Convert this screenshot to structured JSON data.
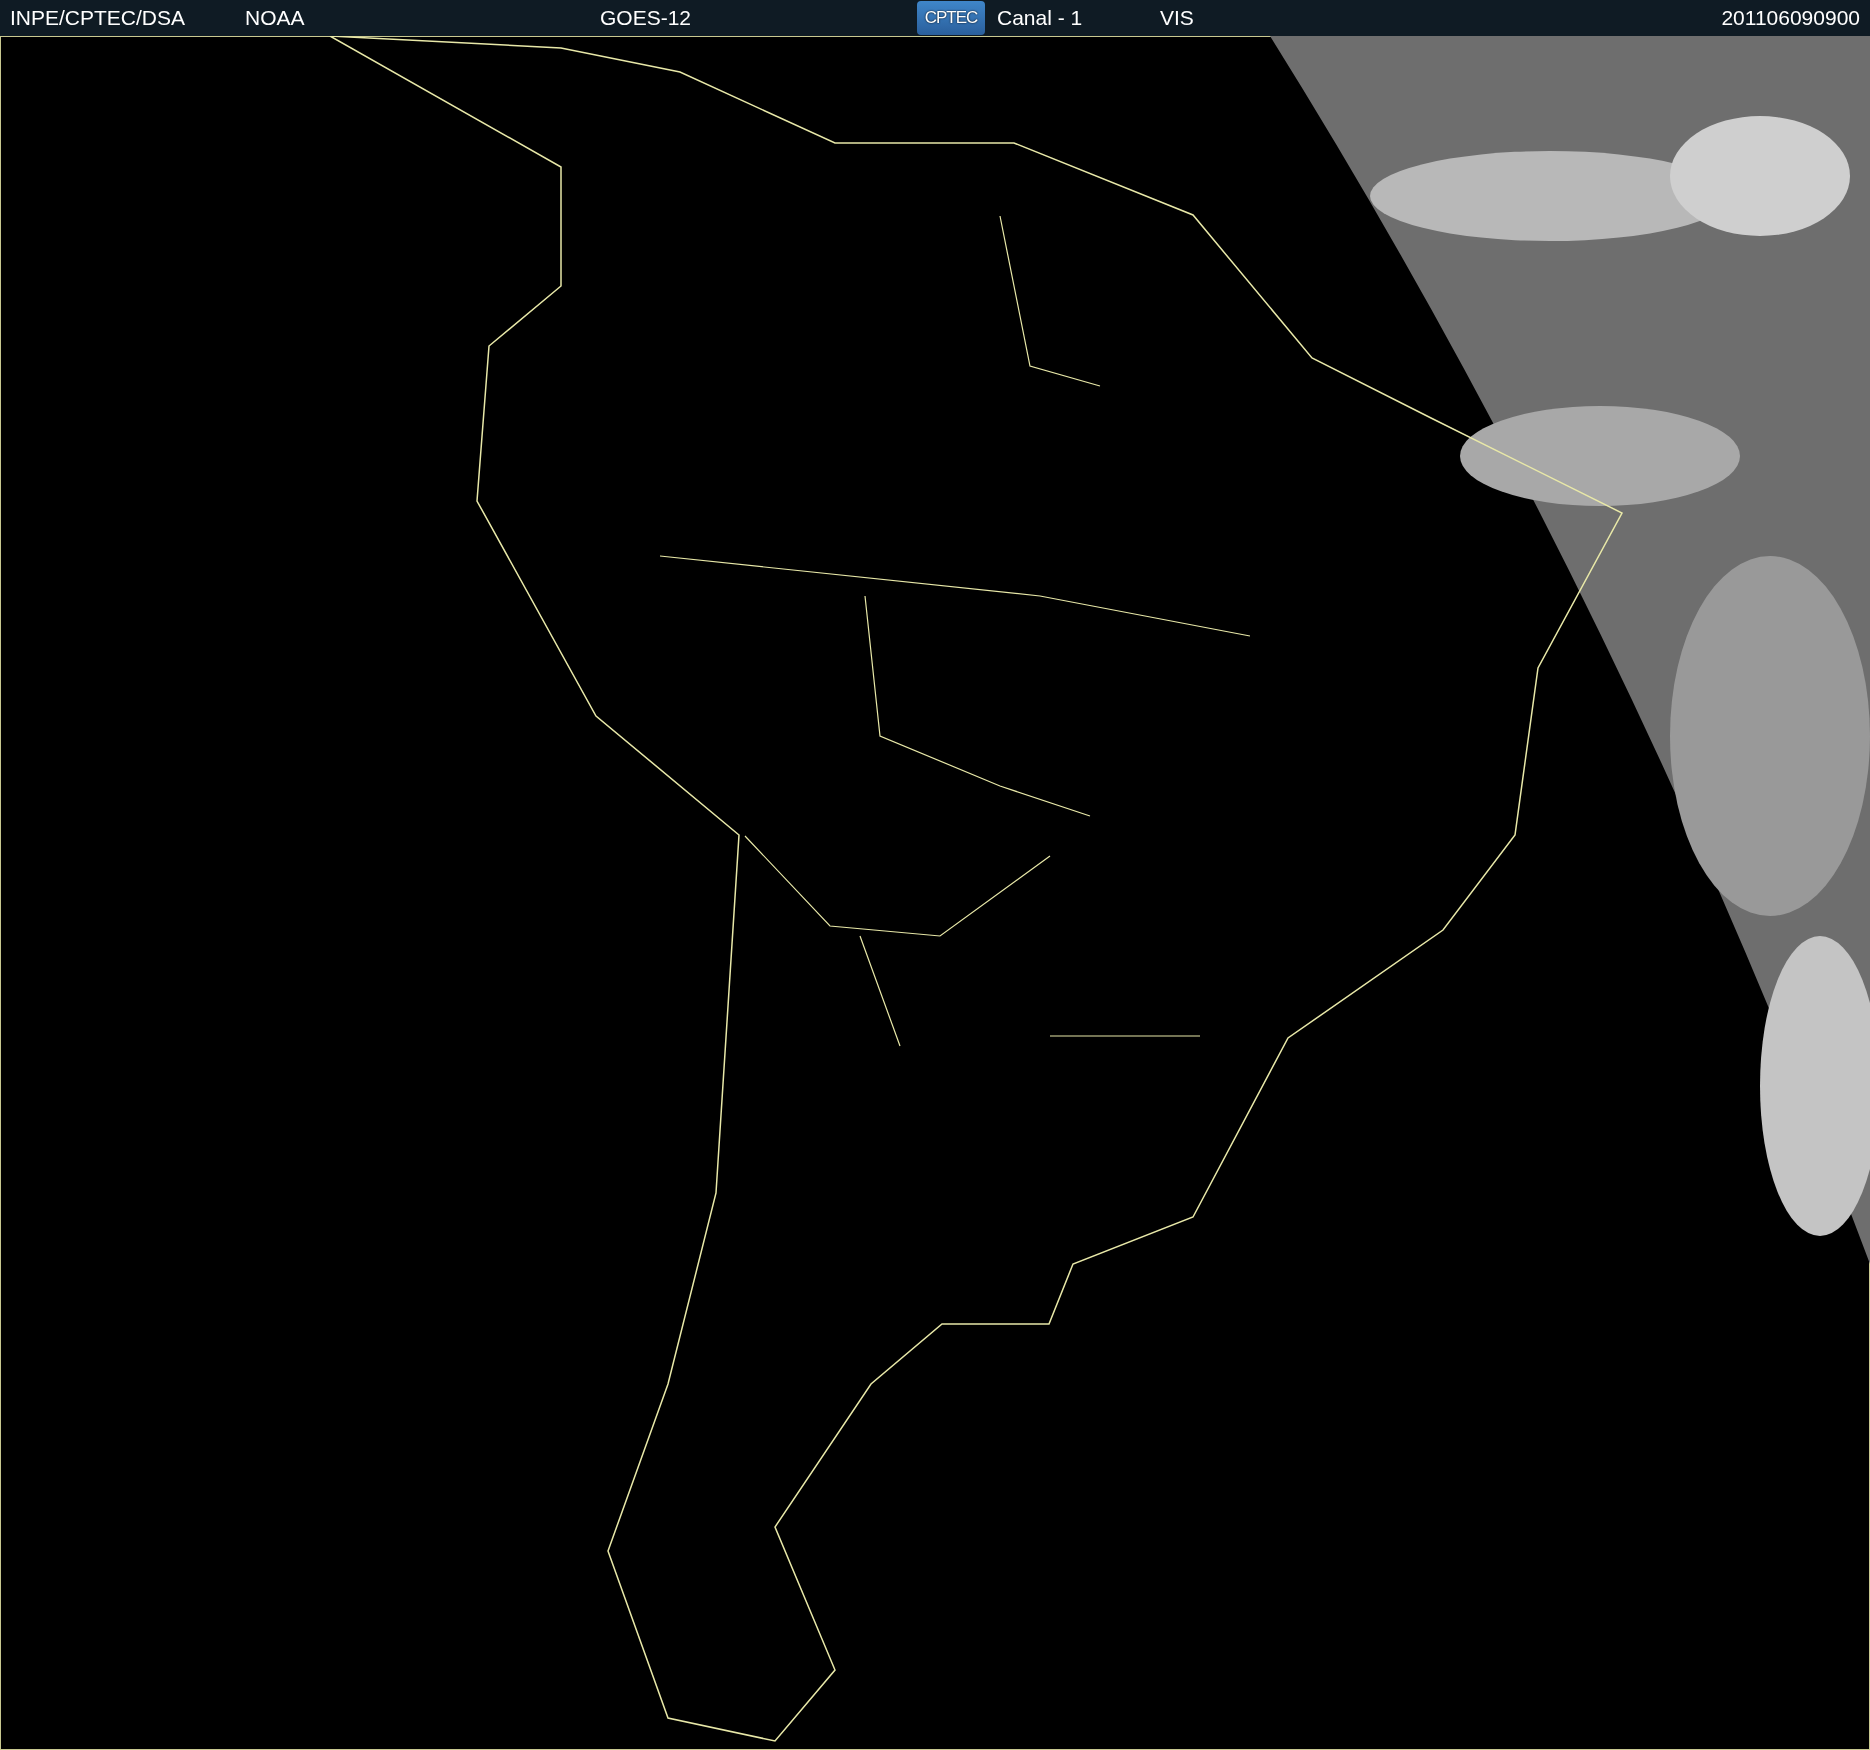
{
  "header": {
    "source": "INPE/CPTEC/DSA",
    "agency": "NOAA",
    "satellite": "GOES-12",
    "logo": "CPTEC",
    "channel": "Canal - 1",
    "band": "VIS",
    "timestamp": "201106090900"
  }
}
